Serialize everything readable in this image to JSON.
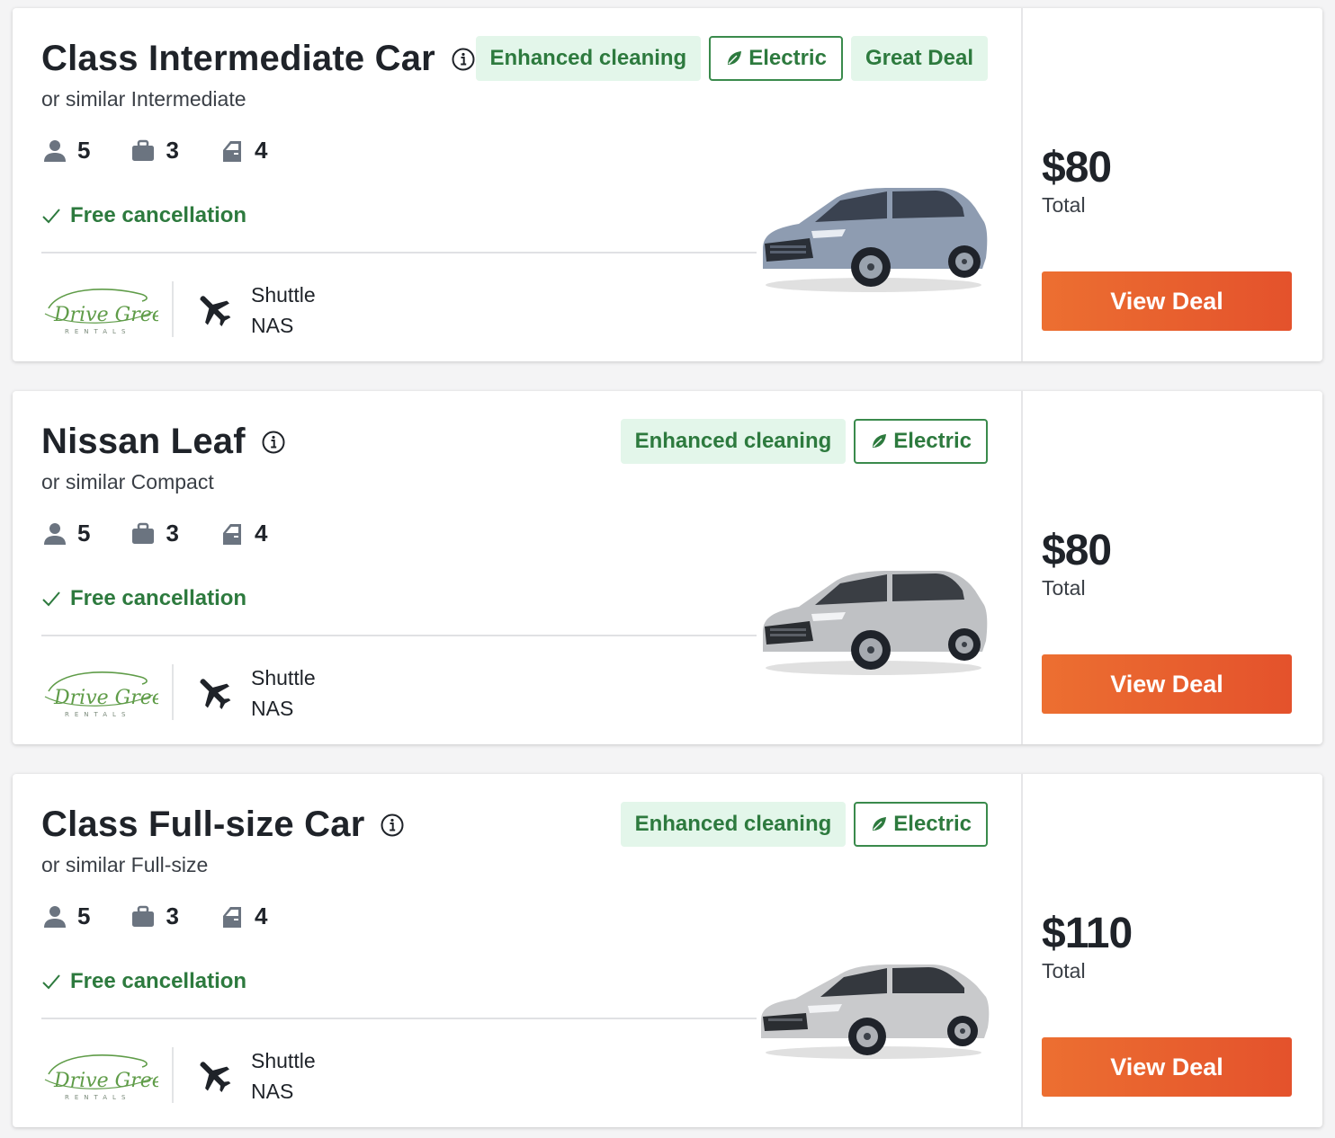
{
  "listings": [
    {
      "title": "Class Intermediate Car",
      "similar": "or similar Intermediate",
      "badges": [
        {
          "label": "Enhanced cleaning",
          "style": "fill"
        },
        {
          "label": "Electric",
          "style": "outline",
          "icon": "leaf-icon"
        },
        {
          "label": "Great Deal",
          "style": "fill"
        }
      ],
      "specs": {
        "passengers": "5",
        "bags": "3",
        "doors": "4"
      },
      "free_cancellation": "Free cancellation",
      "supplier": "Drive Green Rentals",
      "pickup_type": "Shuttle",
      "pickup_code": "NAS",
      "price": "$80",
      "price_label": "Total",
      "cta": "View Deal",
      "car_color": "#8e9cb1"
    },
    {
      "title": "Nissan Leaf",
      "similar": "or similar Compact",
      "badges": [
        {
          "label": "Enhanced cleaning",
          "style": "fill"
        },
        {
          "label": "Electric",
          "style": "outline",
          "icon": "leaf-icon"
        }
      ],
      "specs": {
        "passengers": "5",
        "bags": "3",
        "doors": "4"
      },
      "free_cancellation": "Free cancellation",
      "supplier": "Drive Green Rentals",
      "pickup_type": "Shuttle",
      "pickup_code": "NAS",
      "price": "$80",
      "price_label": "Total",
      "cta": "View Deal",
      "car_color": "#bfc1c4"
    },
    {
      "title": "Class Full-size Car",
      "similar": "or similar Full-size",
      "badges": [
        {
          "label": "Enhanced cleaning",
          "style": "fill"
        },
        {
          "label": "Electric",
          "style": "outline",
          "icon": "leaf-icon"
        }
      ],
      "specs": {
        "passengers": "5",
        "bags": "3",
        "doors": "4"
      },
      "free_cancellation": "Free cancellation",
      "supplier": "Drive Green Rentals",
      "pickup_type": "Shuttle",
      "pickup_code": "NAS",
      "price": "$110",
      "price_label": "Total",
      "cta": "View Deal",
      "car_color": "#c9cacc"
    }
  ],
  "colors": {
    "accent_green": "#2d7a3e",
    "badge_fill": "#e3f6ea",
    "cta_orange": "#ec6f31",
    "cta_orange_dark": "#e4522c",
    "icon_gray": "#6b7480"
  }
}
